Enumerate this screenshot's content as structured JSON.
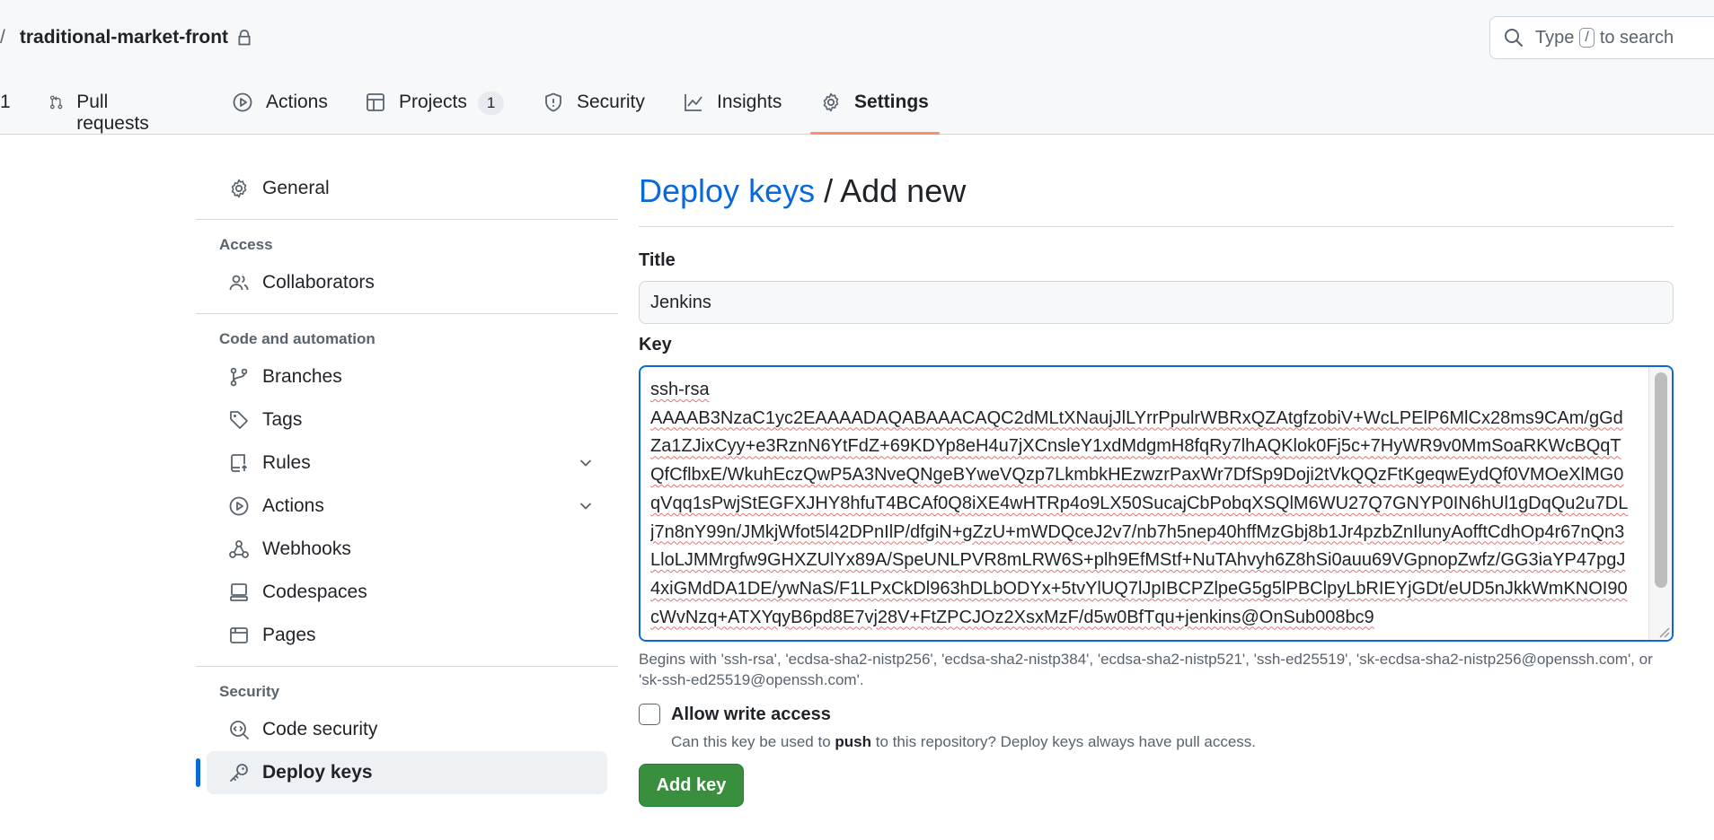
{
  "repo": {
    "separator": "/",
    "name": "traditional-market-front",
    "lock_icon": "lock-icon"
  },
  "search": {
    "icon": "search-icon",
    "prefix": "Type",
    "key": "/",
    "suffix": "to search"
  },
  "tabs": [
    {
      "label": "1",
      "icon": "",
      "count": ""
    },
    {
      "label": "Pull requests",
      "icon": "git-pull-request-icon",
      "count": ""
    },
    {
      "label": "Actions",
      "icon": "play-icon",
      "count": ""
    },
    {
      "label": "Projects",
      "icon": "table-icon",
      "count": "1"
    },
    {
      "label": "Security",
      "icon": "shield-icon",
      "count": ""
    },
    {
      "label": "Insights",
      "icon": "graph-icon",
      "count": ""
    },
    {
      "label": "Settings",
      "icon": "gear-icon",
      "count": "",
      "active": true
    }
  ],
  "sidebar": {
    "general": "General",
    "access_heading": "Access",
    "collaborators": "Collaborators",
    "code_heading": "Code and automation",
    "branches": "Branches",
    "tags": "Tags",
    "rules": "Rules",
    "actions": "Actions",
    "webhooks": "Webhooks",
    "codespaces": "Codespaces",
    "pages": "Pages",
    "security_heading": "Security",
    "code_security": "Code security",
    "deploy_keys": "Deploy keys"
  },
  "main": {
    "title_link": "Deploy keys",
    "title_rest": " / Add new",
    "title_label": "Title",
    "title_value": "Jenkins",
    "key_label": "Key",
    "key_value": "ssh-rsa\nAAAAB3NzaC1yc2EAAAADAQABAAACAQC2dMLtXNaujJlLYrrPpulrWBRxQZAtgfzobiV+WcLPElP6MlCx28ms9CAm/gGdZa1ZJixCyy+e3RznN6YtFdZ+69KDYp8eH4u7jXCnsleY1xdMdgmH8fqRy7lhAQKlok0Fj5c+7HyWR9v0MmSoaRKWcBQqTQfCflbxE/WkuhEczQwP5A3NveQNgeBYweVQzp7LkmbkHEzwzrPaxWr7DfSp9Doji2tVkQQzFtKgeqwEydQf0VMOeXlMG0qVqq1sPwjStEGFXJHY8hfuT4BCAf0Q8iXE4wHTRp4o9LX50SucajCbPobqXSQlM6WU27Q7GNYP0IN6hUl1gDqQu2u7DLj7n8nY99n/JMkjWfot5l42DPnIlP/dfgiN+gZzU+mWDQceJ2v7/nb7h5nep40hffMzGbj8b1Jr4pzbZnIlunyAofftCdhOp4r67nQn3LloLJMMrgfw9GHXZUlYx89A/SpeUNLPVR8mLRW6S+plh9EfMStf+NuTAhvyh6Z8hSi0auu69VGpnopZwfz/GG3iaYP47pgJ4xiGMdDA1DE/ywNaS/F1LPxCkDl963hDLbODYx+5tvYlUQ7lJpIBCPZlpeG5g5lPBClpyLbRIEYjGDt/eUD5nJkkWmKNOI90cWvNzq+ATXYqyB6pd8E7vj28V+FtZPCJOz2XsxMzF/d5w0BfTqu+jenkins@OnSub008bc9",
    "hint": "Begins with 'ssh-rsa', 'ecdsa-sha2-nistp256', 'ecdsa-sha2-nistp384', 'ecdsa-sha2-nistp521', 'ssh-ed25519', 'sk-ecdsa-sha2-nistp256@openssh.com', or 'sk-ssh-ed25519@openssh.com'.",
    "allow_label": "Allow write access",
    "allow_desc_1": "Can this key be used to ",
    "allow_desc_bold": "push",
    "allow_desc_2": " to this repository? Deploy keys always have pull access.",
    "add_button": "Add key"
  },
  "colors": {
    "link": "#0969da",
    "primary_button": "#3a8f3f",
    "tab_underline": "#fd8c73"
  }
}
